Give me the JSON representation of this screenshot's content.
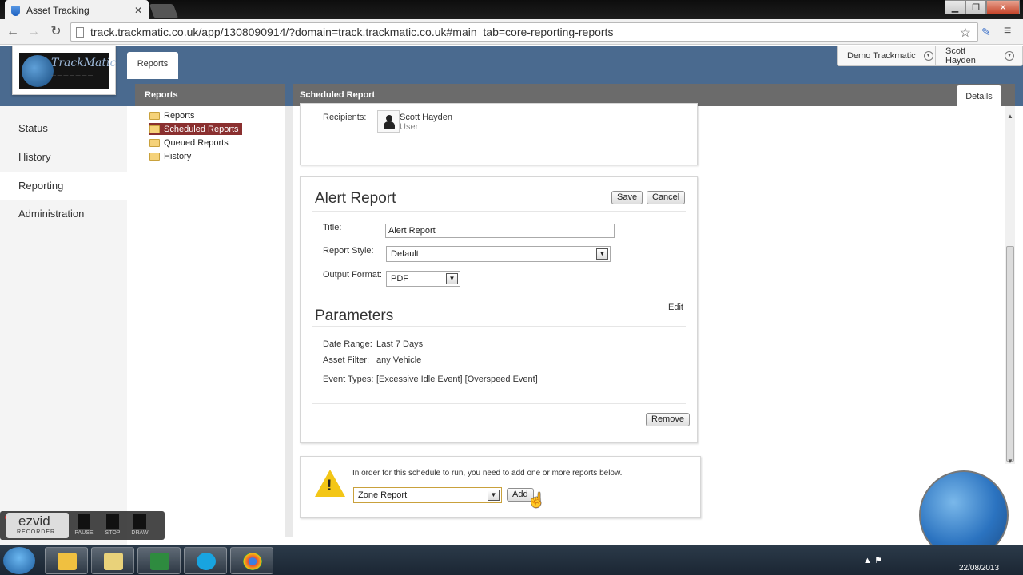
{
  "browser": {
    "tab_title": "Asset Tracking",
    "url": "track.trackmatic.co.uk/app/1308090914/?domain=track.trackmatic.co.uk#main_tab=core-reporting-reports"
  },
  "header": {
    "logo_text": "TrackMatic",
    "tab_reports": "Reports",
    "org_menu": "Demo Trackmatic",
    "user_menu": "Scott Hayden"
  },
  "left_nav": {
    "items": [
      {
        "label": "Status"
      },
      {
        "label": "History"
      },
      {
        "label": "Reporting"
      },
      {
        "label": "Administration"
      }
    ]
  },
  "tree": {
    "header": "Reports",
    "items": [
      {
        "label": "Reports"
      },
      {
        "label": "Scheduled Reports"
      },
      {
        "label": "Queued Reports"
      },
      {
        "label": "History"
      }
    ]
  },
  "main": {
    "header": "Scheduled Report",
    "details_tab": "Details",
    "recipients_label": "Recipients:",
    "recipient_name": "Scott Hayden",
    "recipient_role": "User",
    "report": {
      "title": "Alert Report",
      "save_label": "Save",
      "cancel_label": "Cancel",
      "title_label": "Title:",
      "title_value": "Alert Report",
      "style_label": "Report Style:",
      "style_value": "Default",
      "format_label": "Output Format:",
      "format_value": "PDF",
      "parameters_title": "Parameters",
      "edit_label": "Edit",
      "date_range_label": "Date Range:",
      "date_range_value": "Last 7 Days",
      "asset_filter_label": "Asset Filter:",
      "asset_filter_value": "any Vehicle",
      "event_types_label": "Event Types:",
      "event_types_value": "[Excessive Idle Event] [Overspeed Event]",
      "remove_label": "Remove"
    },
    "add_report": {
      "message": "In order for this schedule to run, you need to add one or more reports below.",
      "select_value": "Zone Report",
      "add_label": "Add"
    }
  },
  "ezvid": {
    "logo": "ezvid",
    "sub": "RECORDER",
    "pause": "PAUSE",
    "stop": "STOP",
    "draw": "DRAW"
  },
  "taskbar": {
    "clock": "22/08/2013"
  },
  "colors": {
    "header_blue": "#4a6a8f",
    "panel_grey": "#6b6b6b",
    "selected_red": "#8a2f2f",
    "warning_yellow": "#f3c617"
  }
}
